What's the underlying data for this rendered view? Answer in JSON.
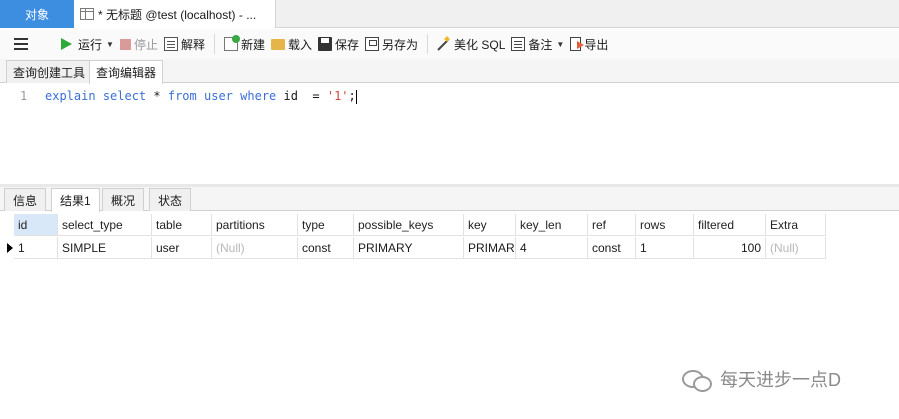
{
  "tabs": {
    "objects": "对象",
    "query": "* 无标题 @test (localhost) - ..."
  },
  "toolbar": {
    "run": "运行",
    "stop": "停止",
    "explain": "解释",
    "new": "新建",
    "load": "载入",
    "save": "保存",
    "save_as": "另存为",
    "beautify": "美化 SQL",
    "note": "备注",
    "export": "导出"
  },
  "editor_tabs": [
    "查询创建工具",
    "查询编辑器"
  ],
  "editor": {
    "line_number": "1",
    "tokens": {
      "explain": "explain",
      "select": "select",
      "star": " * ",
      "from": "from",
      "table": "user",
      "where": "where",
      "rest": " id  = ",
      "value": "'1'",
      "semicolon": ";"
    }
  },
  "result_tabs": [
    "信息",
    "结果1",
    "概况",
    "状态"
  ],
  "result": {
    "columns": [
      "id",
      "select_type",
      "table",
      "partitions",
      "type",
      "possible_keys",
      "key",
      "key_len",
      "ref",
      "rows",
      "filtered",
      "Extra"
    ],
    "rows": [
      [
        "1",
        "SIMPLE",
        "user",
        "(Null)",
        "const",
        "PRIMARY",
        "PRIMARY",
        "4",
        "const",
        "1",
        "100",
        "(Null)"
      ]
    ]
  },
  "watermark": "每天进步一点D"
}
